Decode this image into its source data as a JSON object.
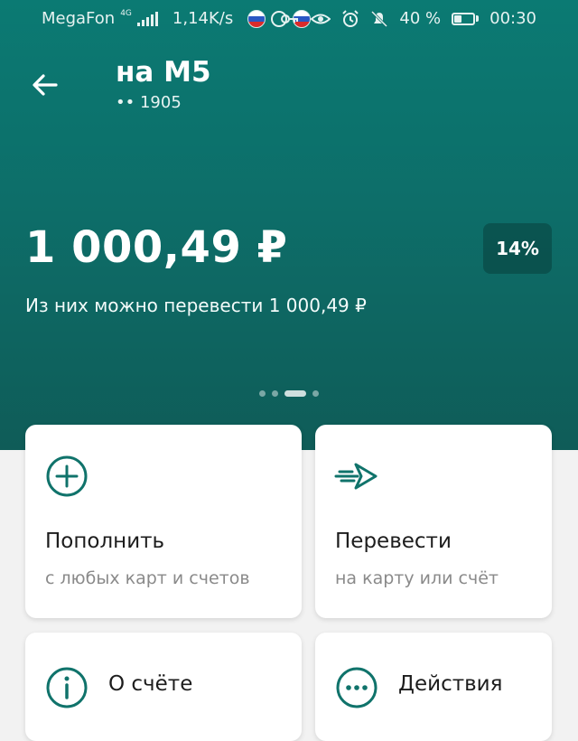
{
  "status_bar": {
    "carrier": "MegaFon",
    "network": "4G",
    "speed": "1,14K/s",
    "battery_percent": "40 %",
    "battery_level": 0.4,
    "time": "00:30"
  },
  "header": {
    "title": "на M5",
    "account_mask": "•• 1905",
    "balance": "1 000,49 ₽",
    "rate": "14%",
    "available_text": "Из них можно перевести 1 000,49 ₽",
    "pager": {
      "count": 4,
      "active_index": 2
    }
  },
  "actions": {
    "top_up": {
      "title": "Пополнить",
      "subtitle": "с любых карт и счетов",
      "icon": "plus-circle-icon"
    },
    "transfer": {
      "title": "Перевести",
      "subtitle": "на карту или счёт",
      "icon": "transfer-arrow-icon"
    },
    "about": {
      "title": "О счёте",
      "icon": "info-icon"
    },
    "more": {
      "title": "Действия",
      "icon": "more-dots-icon"
    }
  },
  "colors": {
    "accent": "#0b7a73",
    "icon": "#10736b"
  }
}
